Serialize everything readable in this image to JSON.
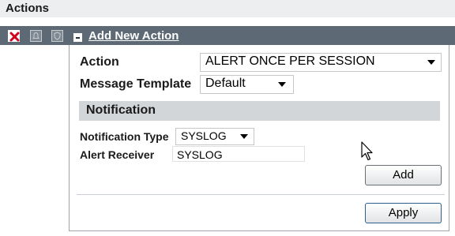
{
  "section_title": "Actions",
  "toolbar": {
    "close_icon": "close-icon",
    "bell_icon": "bell-icon",
    "shield_icon": "shield-icon",
    "collapse_icon": "minus-collapse-icon",
    "title": "Add New Action",
    "close_color": "#d0021b"
  },
  "form": {
    "action_label": "Action",
    "action_value": "ALERT ONCE PER SESSION",
    "template_label": "Message Template",
    "template_value": "Default"
  },
  "notification": {
    "heading": "Notification",
    "type_label": "Notification Type",
    "type_value": "SYSLOG",
    "receiver_label": "Alert Receiver",
    "receiver_value": "SYSLOG",
    "add_label": "Add"
  },
  "footer": {
    "apply_label": "Apply"
  },
  "colors": {
    "titlebar": "#5d6a76",
    "section_band": "#d3d6d9",
    "header_band": "#eceef0"
  }
}
